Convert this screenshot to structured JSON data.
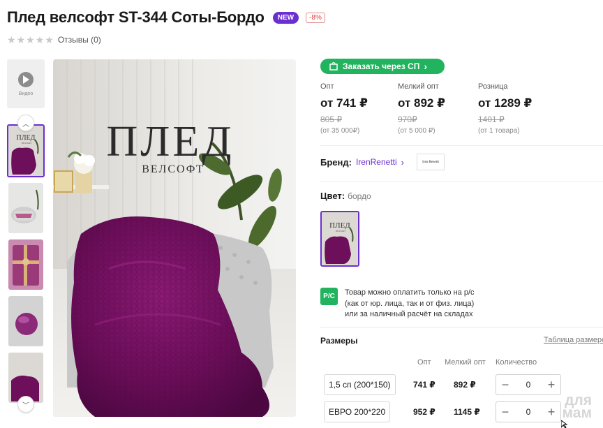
{
  "product": {
    "title": "Плед велсофт ST-344 Соты-Бордо",
    "badge_new": "NEW",
    "badge_discount": "-8%",
    "rating_stars": 0,
    "reviews": "Отзывы (0)"
  },
  "gallery": {
    "video_label": "Видео",
    "main_image_text_line1": "ПЛЕД",
    "main_image_text_line2": "ВЕЛСОФТ",
    "thumb_text_line1": "ПЛЕД",
    "thumb_text_line2": "ВЕЛСОФТ"
  },
  "purchase": {
    "sp_button": "Заказать через СП"
  },
  "prices": [
    {
      "label": "Опт",
      "value": "от 741 ₽",
      "old": "805 ₽",
      "min": "(от 35 000₽)"
    },
    {
      "label": "Мелкий опт",
      "value": "от 892 ₽",
      "old": "970₽",
      "min": "(от 5 000 ₽)"
    },
    {
      "label": "Розница",
      "value": "от 1289 ₽",
      "old": "1401 ₽",
      "min": "(от 1 товара)"
    }
  ],
  "brand": {
    "label": "Бренд:",
    "name": "IrenRenetti",
    "chevron": "›",
    "logo_text": "Iren Renetti"
  },
  "color": {
    "label": "Цвет:",
    "value": "бордо"
  },
  "payment": {
    "icon_text": "P/C",
    "line1": "Товар можно оплатить только на р/с",
    "line2": "(как от юр. лица, так и от физ. лица)",
    "line3": "или за наличный расчёт на складах"
  },
  "sizes": {
    "title": "Размеры",
    "table_link": "Таблица размеров",
    "col_opt": "Опт",
    "col_small": "Мелкий опт",
    "col_qty": "Количество",
    "rows": [
      {
        "name": "1,5 сп (200*150)",
        "opt": "741 ₽",
        "small": "892 ₽",
        "qty": "0"
      },
      {
        "name": "ЕВРО 200*220",
        "opt": "952 ₽",
        "small": "1145 ₽",
        "qty": "0"
      }
    ]
  },
  "watermark": {
    "line1": "для",
    "line2": "мам"
  },
  "colors": {
    "accent": "#6b2fd0",
    "green": "#21b35d",
    "plaid": "#6e0f5c"
  }
}
